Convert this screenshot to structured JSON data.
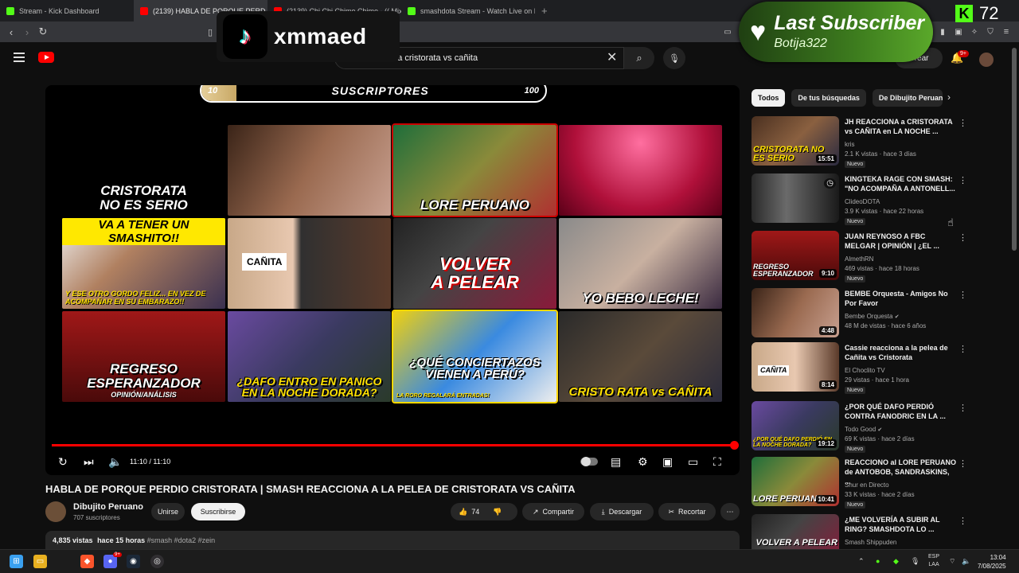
{
  "browser": {
    "tabs": [
      {
        "label": "Stream - Kick Dashboard",
        "color": "#53fc18"
      },
      {
        "label": "(2139) HABLA DE PORQUE PERD",
        "color": "#ff0000"
      },
      {
        "label": "(2139) Chi Chi Chimo Chimo - (( Mix",
        "color": "#ff0000"
      },
      {
        "label": "smashdota Stream - Watch Live on K",
        "color": "#53fc18"
      }
    ],
    "new_tab": "+"
  },
  "header": {
    "search_value": "smash analiza cristorata vs cañita",
    "create_label": "Crear",
    "notifications": "9+"
  },
  "overlays": {
    "tiktok_handle": "xmmaed",
    "last_sub_title": "Last Subscriber",
    "last_sub_name": "Botija322",
    "kick_count": "72",
    "sub_goal_current": "10",
    "sub_goal_label": "SUSCRIPTORES",
    "sub_goal_max": "100",
    "sub_goal_fraction": 0.1
  },
  "thumbs": [
    {
      "line1": "CRISTORATA",
      "line2": "NO ES SERIO"
    },
    {
      "line1": "",
      "line2": ""
    },
    {
      "line1": "LORE",
      "line2": "PERUANO"
    },
    {
      "line1": "",
      "line2": ""
    },
    {
      "top": "VA A TENER UN SMASHITO!!",
      "sub": "Y ESE OTRO GORDO FELIZ... EN VEZ DE ACOMPAÑAR EN SU EMBARAZO!!"
    },
    {
      "label": "CAÑITA"
    },
    {
      "line1": "VOLVER",
      "line2": "A PELEAR"
    },
    {
      "line1": "YO BEBO LECHE!"
    },
    {
      "line1": "REGRESO ESPERANZADOR",
      "sub": "OPINIÓN/ANÁLISIS"
    },
    {
      "line1": "¿DAFO ENTRO EN PANICO",
      "line2": "EN LA NOCHE DORADA?"
    },
    {
      "line1": "¿QUÉ CONCIERTAZOS",
      "line2": "VIENEN A PERÚ?",
      "sub": "LA RORO REGALARÁ ENTRADAS!"
    },
    {
      "line1": "CRISTO RATA vs CAÑITA"
    }
  ],
  "player": {
    "time": "11:10 / 11:10",
    "progress": 1.0
  },
  "video": {
    "title": "HABLA DE PORQUE PERDIO CRISTORATA | SMASH REACCIONA A LA PELEA DE CRISTORATA VS CAÑITA",
    "channel": "Dibujito Peruano",
    "subs": "707 suscriptores",
    "join": "Unirse",
    "subscribe": "Suscribirse",
    "likes": "74",
    "share": "Compartir",
    "download": "Descargar",
    "clip": "Recortar",
    "views": "4,835 vistas",
    "age": "hace 15 horas",
    "tags": "#smash #dota2 #zein"
  },
  "chips": [
    "Todos",
    "De tus búsquedas",
    "De Dibujito Peruano"
  ],
  "recs": [
    {
      "title": "JH REACCIONA a CRISTORATA vs CAÑITA en LA NOCHE ...",
      "channel": "kris",
      "meta": "2.1 K vistas · hace 3 días",
      "dur": "15:51",
      "new": "Nuevo",
      "thumb": "CRISTORATA NO ES SERIO"
    },
    {
      "title": "KINGTEKA RAGE CON SMASH: \"NO ACOMPAÑA A ANTONELL...",
      "channel": "ClideoDOTA",
      "meta": "3.9 K vistas · hace 22 horas",
      "dur": "",
      "new": "Nuevo",
      "thumb": ""
    },
    {
      "title": "JUAN REYNOSO A FBC MELGAR | OPINIÓN | ¿EL ...",
      "channel": "AlmethRN",
      "meta": "469 vistas · hace 18 horas",
      "dur": "9:10",
      "new": "Nuevo",
      "thumb": "REGRESO ESPERANZADOR"
    },
    {
      "title": "BEMBE Orquesta - Amigos No Por Favor",
      "channel": "Bembe Orquesta",
      "meta": "48 M de vistas · hace 6 años",
      "dur": "4:48",
      "new": "",
      "thumb": ""
    },
    {
      "title": "Cassie reacciona a la pelea de Cañita vs Cristorata",
      "channel": "El Choclito TV",
      "meta": "29 vistas · hace 1 hora",
      "dur": "8:14",
      "new": "Nuevo",
      "thumb": "CAÑITA"
    },
    {
      "title": "¿POR QUÉ DAFO PERDIÓ CONTRA FANODRIC EN LA ...",
      "channel": "Todo Good",
      "meta": "69 K vistas · hace 2 días",
      "dur": "19:12",
      "new": "Nuevo",
      "thumb": "¿POR QUÉ DAFO PERDIÓ EN LA NOCHE DORADA?"
    },
    {
      "title": "REACCIONO al LORE PERUANO de ANTOBOB, SANDRASKINS, ...",
      "channel": "Shur en Directo",
      "meta": "33 K vistas · hace 2 días",
      "dur": "10:41",
      "new": "Nuevo",
      "thumb": "LORE PERUANO"
    },
    {
      "title": "¿ME VOLVERÍA A SUBIR AL RING? SMASHDOTA LO ...",
      "channel": "Smash Shippuden",
      "meta": "",
      "dur": "",
      "new": "",
      "thumb": "VOLVER A PELEAR"
    }
  ],
  "taskbar": {
    "lang1": "ESP",
    "lang2": "LAA",
    "time": "13:04",
    "date": "7/08/2025",
    "chat_badge": "9+"
  }
}
